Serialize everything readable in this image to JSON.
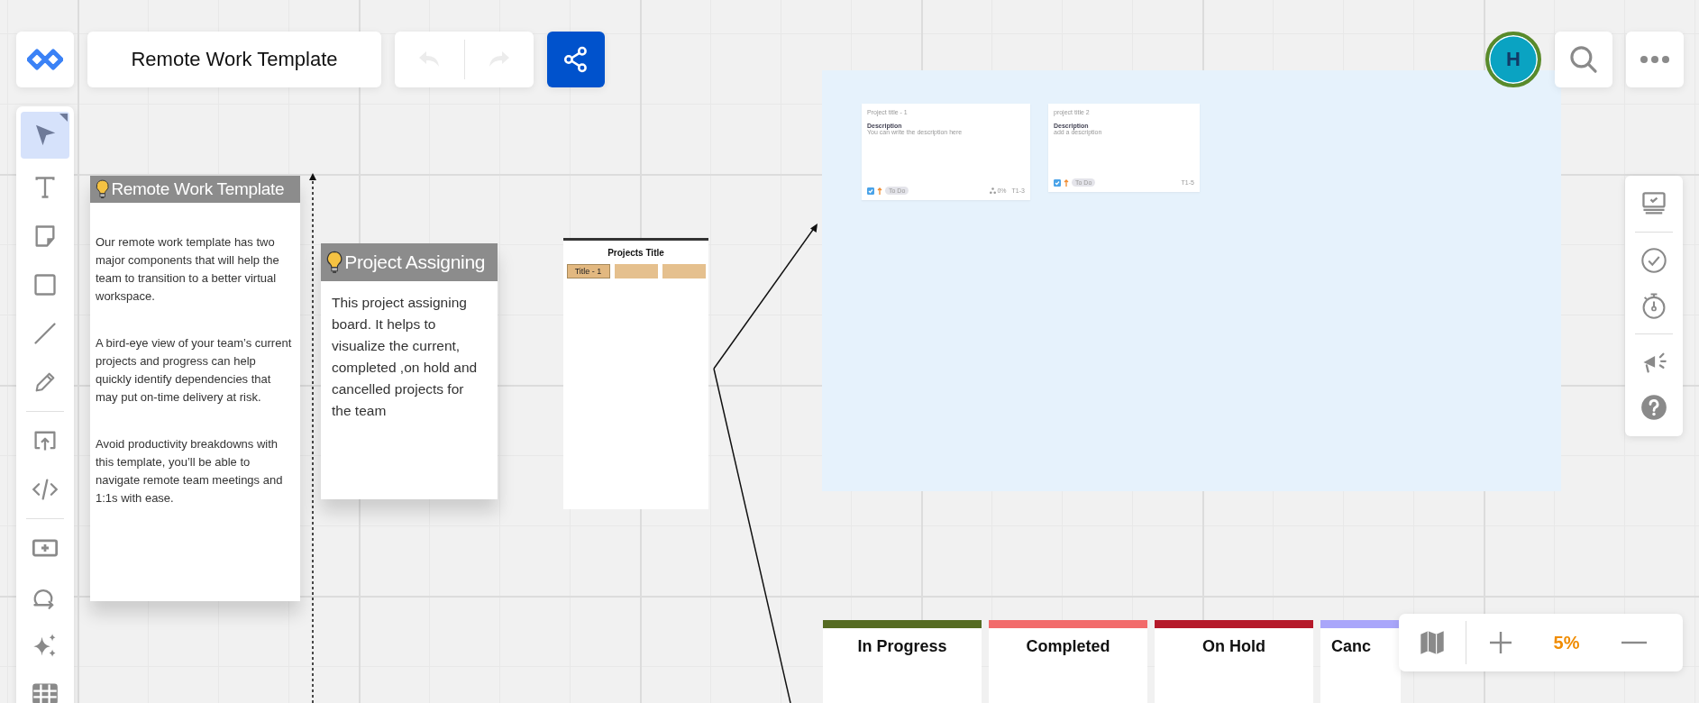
{
  "header": {
    "title": "Remote Work Template"
  },
  "history": [
    {
      "kind": "undo",
      "disabled": true
    },
    {
      "kind": "redo",
      "disabled": true
    }
  ],
  "avatar": {
    "initial": "H"
  },
  "left_toolbar": [
    {
      "kind": "select",
      "selected": true
    },
    {
      "kind": "text",
      "selected": false
    },
    {
      "kind": "sticky",
      "selected": false
    },
    {
      "kind": "shape",
      "selected": false
    },
    {
      "kind": "line",
      "selected": false
    },
    {
      "kind": "pen",
      "selected": false
    },
    {
      "kind": "divider"
    },
    {
      "kind": "upload",
      "selected": false
    },
    {
      "kind": "embed",
      "selected": false
    },
    {
      "kind": "divider"
    },
    {
      "kind": "frame",
      "selected": false
    },
    {
      "kind": "loop",
      "selected": false
    },
    {
      "kind": "ai",
      "selected": false
    },
    {
      "kind": "table",
      "selected": false
    }
  ],
  "notes": [
    {
      "title": "Remote Work Template",
      "paragraphs": [
        "Our remote work template has two major components that will help the team to transition to a better virtual workspace.",
        "A bird-eye view of your team’s current projects and progress can help quickly identify dependencies that may put on-time delivery at risk.",
        "Avoid productivity breakdowns with this template, you’ll be able to navigate remote team meetings and 1:1s with ease."
      ]
    },
    {
      "title": "Project Assigning",
      "paragraphs": [
        "This project assigning board. It helps to visualize the current, completed ,on hold and cancelled projects for the team"
      ]
    }
  ],
  "kanban": {
    "title": "Projects Title",
    "cards": [
      {
        "kind": "labeled",
        "label": "Title - 1"
      },
      {
        "kind": "blank"
      },
      {
        "kind": "blank"
      }
    ]
  },
  "task_cards": [
    {
      "title": "Project title - 1",
      "description_label": "Description",
      "description": "You can write the description here",
      "checked": true,
      "status": "To Do",
      "progress": "0%",
      "key": "T1-3"
    },
    {
      "title": "project title 2",
      "description_label": "Description",
      "description": "add a description",
      "checked": true,
      "status": "To Do",
      "key": "T1-5"
    }
  ],
  "status_columns": [
    {
      "label": "In Progress",
      "color": "#556b22"
    },
    {
      "label": "Completed",
      "color": "#f26b6b"
    },
    {
      "label": "On Hold",
      "color": "#b5192a"
    },
    {
      "label": "Canc",
      "color": "#a9a6fa"
    }
  ],
  "side_panel": [
    {
      "kind": "present"
    },
    {
      "kind": "divider"
    },
    {
      "kind": "check"
    },
    {
      "kind": "timer"
    },
    {
      "kind": "divider"
    },
    {
      "kind": "announce"
    },
    {
      "kind": "help"
    }
  ],
  "zoom": {
    "level_text": "5%"
  }
}
